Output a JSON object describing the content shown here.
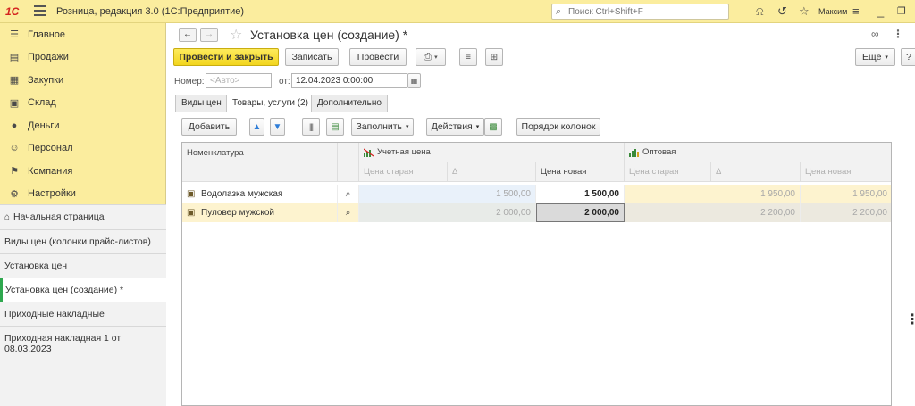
{
  "topbar": {
    "logo": "1С",
    "app_title": "Розница, редакция 3.0  (1С:Предприятие)",
    "search_placeholder": "Поиск Ctrl+Shift+F",
    "username": "Максим"
  },
  "sidebar": {
    "items": [
      {
        "label": "Главное",
        "icon": "menu-lines-icon"
      },
      {
        "label": "Продажи",
        "icon": "cash-register-icon"
      },
      {
        "label": "Закупки",
        "icon": "purchases-icon"
      },
      {
        "label": "Склад",
        "icon": "warehouse-icon"
      },
      {
        "label": "Деньги",
        "icon": "money-icon"
      },
      {
        "label": "Персонал",
        "icon": "people-icon"
      },
      {
        "label": "Компания",
        "icon": "flag-icon"
      },
      {
        "label": "Настройки",
        "icon": "gear-icon"
      }
    ],
    "open_windows": [
      {
        "label": "Начальная страница"
      },
      {
        "label": "Виды цен (колонки прайс-листов)"
      },
      {
        "label": "Установка цен"
      },
      {
        "label": "Установка цен (создание) *"
      },
      {
        "label": "Приходные накладные"
      },
      {
        "label": "Приходная накладная 1 от 08.03.2023"
      }
    ]
  },
  "document": {
    "title": "Установка цен (создание) *",
    "toolbar": {
      "post_close": "Провести и закрыть",
      "save": "Записать",
      "post": "Провести",
      "more": "Еще",
      "help": "?"
    },
    "number_label": "Номер:",
    "number_placeholder": "<Авто>",
    "date_label": "от:",
    "date_value": "12.04.2023  0:00:00"
  },
  "tabs": [
    {
      "label": "Виды цен"
    },
    {
      "label": "Товары, услуги (2)"
    },
    {
      "label": "Дополнительно"
    }
  ],
  "table_toolbar": {
    "add": "Добавить",
    "fill": "Заполнить",
    "actions": "Действия",
    "column_order": "Порядок колонок"
  },
  "table": {
    "col_item": "Номенклатура",
    "group1": "Учетная цена",
    "group2": "Оптовая",
    "sub_old": "Цена старая",
    "sub_delta": "Δ",
    "sub_new": "Цена новая",
    "rows": [
      {
        "name": "Водолазка мужская",
        "g1_old": "1 500,00",
        "g1_delta": "",
        "g1_new": "1 500,00",
        "g2_old": "1 950,00",
        "g2_delta": "",
        "g2_new": "1 950,00"
      },
      {
        "name": "Пуловер мужской",
        "g1_old": "2 000,00",
        "g1_delta": "",
        "g1_new": "2 000,00",
        "g2_old": "",
        "g2_delta": "2 200,00",
        "g2_new": "2 200,00"
      }
    ]
  },
  "colors": {
    "panel_yellow": "#fbed9e",
    "primary_button": "#f2d51e",
    "row_highlight": "#fdf3cf",
    "active_accent": "#2fa84f"
  }
}
